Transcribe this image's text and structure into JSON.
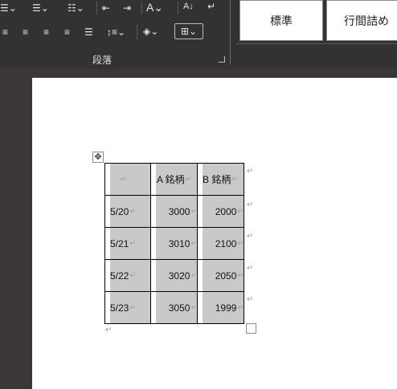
{
  "ribbon": {
    "styles": [
      "標準",
      "行間詰め"
    ],
    "paragraph_group_label": "段落"
  },
  "table": {
    "header": [
      "",
      "A 銘柄",
      "B 銘柄"
    ],
    "rows": [
      [
        "5/20",
        "3000",
        "2000"
      ],
      [
        "5/21",
        "3010",
        "2100"
      ],
      [
        "5/22",
        "3020",
        "2050"
      ],
      [
        "5/23",
        "3050",
        "1999"
      ]
    ]
  },
  "marks": {
    "paragraph": "↵",
    "move": "✥"
  },
  "colors": {
    "ribbon_bg": "#323232",
    "canvas_bg": "#3b3737",
    "cell_shading": "#c9c9c9"
  }
}
